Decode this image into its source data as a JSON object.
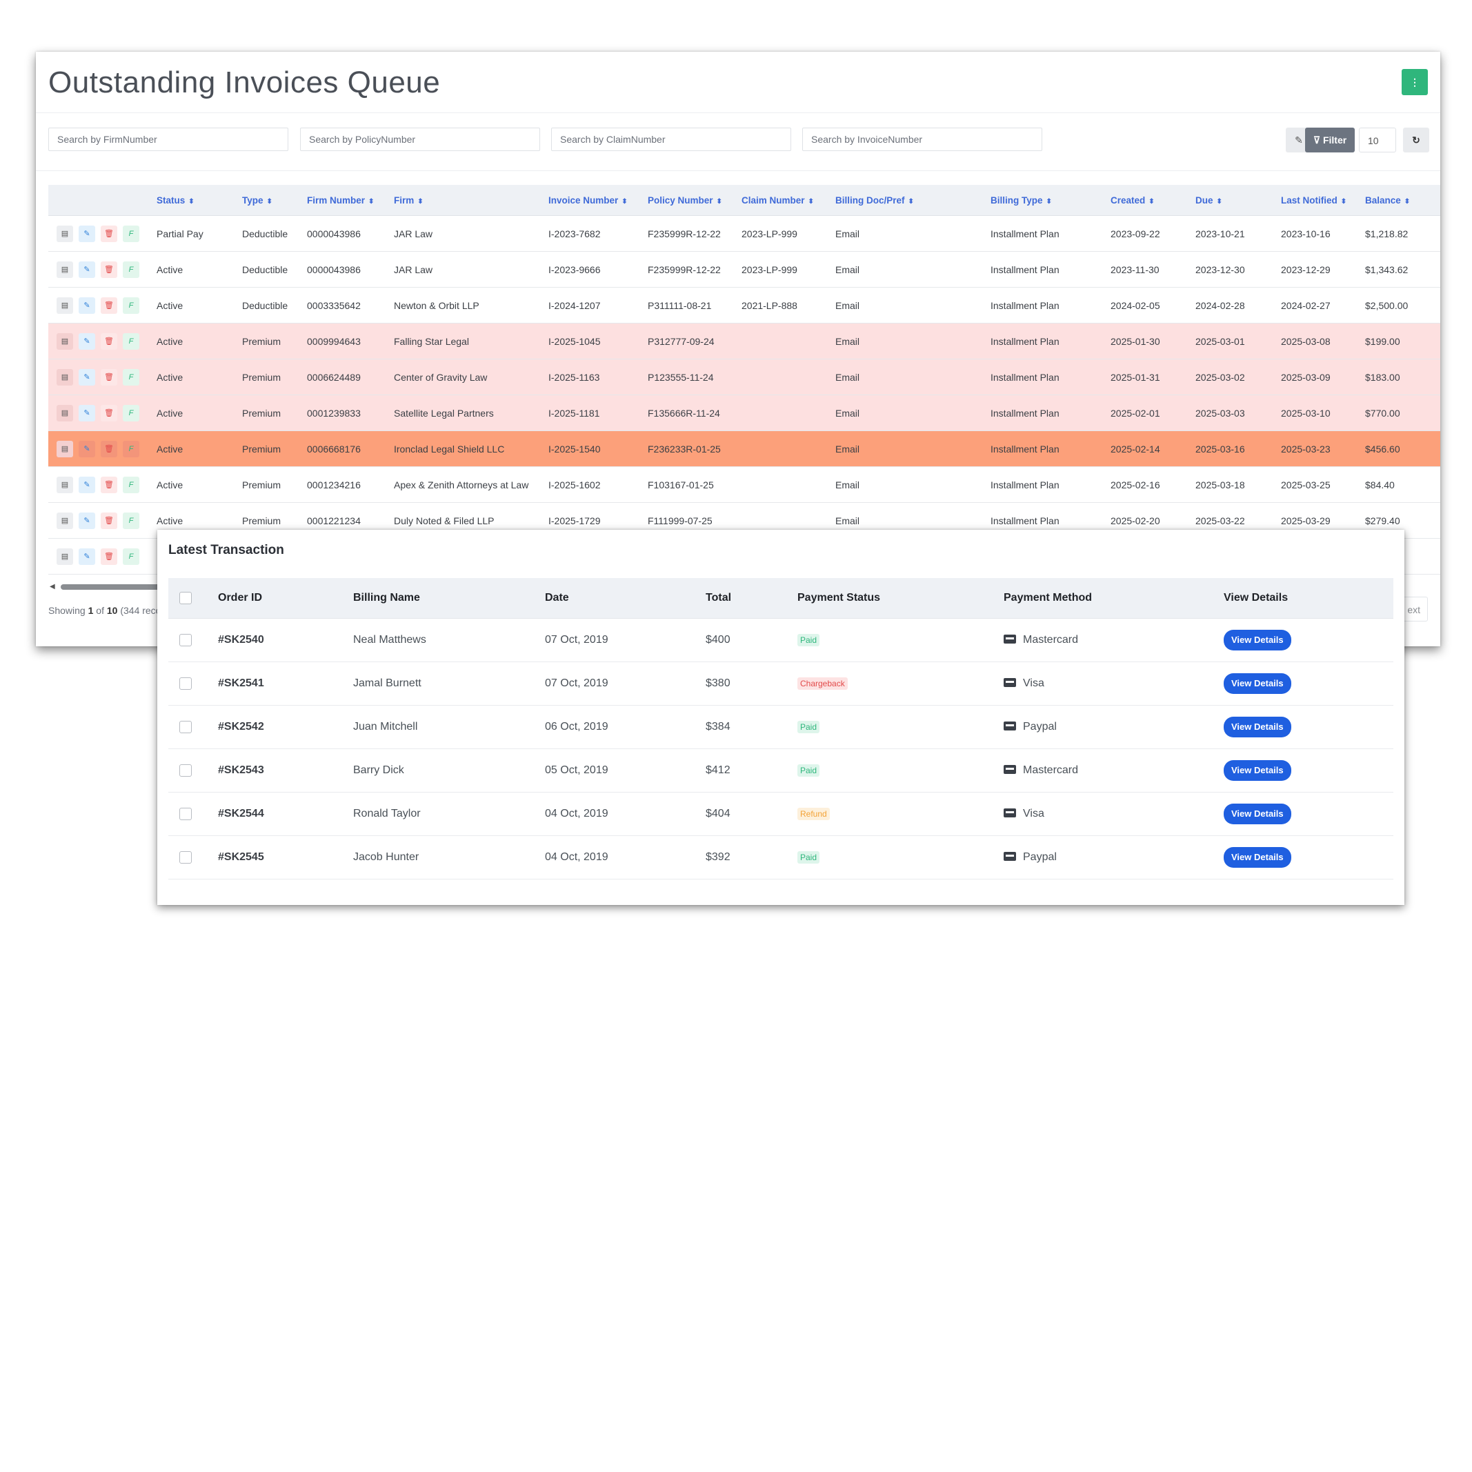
{
  "page": {
    "title": "Outstanding Invoices Queue",
    "menu_icon": "vertical-ellipsis-icon",
    "accent_color": "#2fb67c"
  },
  "search": {
    "firm": "Search by FirmNumber",
    "policy": "Search by PolicyNumber",
    "claim": "Search by ClaimNumber",
    "invoice": "Search by InvoiceNumber"
  },
  "toolbar": {
    "clear_icon": "eraser-icon",
    "filter_label": "⊽ Filter",
    "page_size": "10",
    "refresh_icon": "refresh-icon"
  },
  "invoices": {
    "columns": [
      "Status",
      "Type",
      "Firm Number",
      "Firm",
      "Invoice Number",
      "Policy Number",
      "Claim Number",
      "Billing Doc/Pref",
      "Billing Type",
      "Created",
      "Due",
      "Last Notified",
      "Balance"
    ],
    "rows": [
      {
        "highlight": "none",
        "cells": [
          "Partial Pay",
          "Deductible",
          "0000043986",
          "JAR Law",
          "I-2023-7682",
          "F235999R-12-22",
          "2023-LP-999",
          "Email",
          "Installment Plan",
          "2023-09-22",
          "2023-10-21",
          "2023-10-16",
          "$1,218.82"
        ]
      },
      {
        "highlight": "none",
        "cells": [
          "Active",
          "Deductible",
          "0000043986",
          "JAR Law",
          "I-2023-9666",
          "F235999R-12-22",
          "2023-LP-999",
          "Email",
          "Installment Plan",
          "2023-11-30",
          "2023-12-30",
          "2023-12-29",
          "$1,343.62"
        ]
      },
      {
        "highlight": "none",
        "cells": [
          "Active",
          "Deductible",
          "0003335642",
          "Newton & Orbit LLP",
          "I-2024-1207",
          "P311111-08-21",
          "2021-LP-888",
          "Email",
          "Installment Plan",
          "2024-02-05",
          "2024-02-28",
          "2024-02-27",
          "$2,500.00"
        ]
      },
      {
        "highlight": "pink",
        "cells": [
          "Active",
          "Premium",
          "0009994643",
          "Falling Star Legal",
          "I-2025-1045",
          "P312777-09-24",
          "",
          "Email",
          "Installment Plan",
          "2025-01-30",
          "2025-03-01",
          "2025-03-08",
          "$199.00"
        ]
      },
      {
        "highlight": "pink",
        "cells": [
          "Active",
          "Premium",
          "0006624489",
          "Center of Gravity Law",
          "I-2025-1163",
          "P123555-11-24",
          "",
          "Email",
          "Installment Plan",
          "2025-01-31",
          "2025-03-02",
          "2025-03-09",
          "$183.00"
        ]
      },
      {
        "highlight": "pink",
        "cells": [
          "Active",
          "Premium",
          "0001239833",
          "Satellite Legal Partners",
          "I-2025-1181",
          "F135666R-11-24",
          "",
          "Email",
          "Installment Plan",
          "2025-02-01",
          "2025-03-03",
          "2025-03-10",
          "$770.00"
        ]
      },
      {
        "highlight": "orange",
        "cells": [
          "Active",
          "Premium",
          "0006668176",
          "Ironclad Legal Shield LLC",
          "I-2025-1540",
          "F236233R-01-25",
          "",
          "Email",
          "Installment Plan",
          "2025-02-14",
          "2025-03-16",
          "2025-03-23",
          "$456.60"
        ]
      },
      {
        "highlight": "none",
        "cells": [
          "Active",
          "Premium",
          "0001234216",
          "Apex & Zenith Attorneys at Law",
          "I-2025-1602",
          "F103167-01-25",
          "",
          "Email",
          "Installment Plan",
          "2025-02-16",
          "2025-03-18",
          "2025-03-25",
          "$84.40"
        ]
      },
      {
        "highlight": "none",
        "cells": [
          "Active",
          "Premium",
          "0001221234",
          "Duly Noted & Filed LLP",
          "I-2025-1729",
          "F111999-07-25",
          "",
          "Email",
          "Installment Plan",
          "2025-02-20",
          "2025-03-22",
          "2025-03-29",
          "$279.40"
        ]
      },
      {
        "highlight": "none",
        "cells": [
          "",
          "",
          "",
          "",
          "",
          "",
          "",
          "",
          "",
          "",
          "",
          "",
          ""
        ]
      }
    ],
    "row_action_icons": [
      "document-icon",
      "edit-icon",
      "delete-icon",
      "f-icon"
    ],
    "highlight_colors": {
      "pink": "#fde0e0",
      "orange": "#fca07a"
    }
  },
  "footer": {
    "showing_prefix": "Showing",
    "showing_page": "1",
    "showing_of": "of",
    "showing_total": "10",
    "showing_suffix": "(344 reco",
    "next_label": "ext"
  },
  "transactions": {
    "title": "Latest Transaction",
    "columns": [
      "Order ID",
      "Billing Name",
      "Date",
      "Total",
      "Payment Status",
      "Payment Method",
      "View Details"
    ],
    "rows": [
      {
        "order_id": "#SK2540",
        "name": "Neal Matthews",
        "date": "07 Oct, 2019",
        "total": "$400",
        "status": "Paid",
        "status_type": "paid",
        "method": "Mastercard",
        "method_icon": "mastercard-icon",
        "button": "View Details"
      },
      {
        "order_id": "#SK2541",
        "name": "Jamal Burnett",
        "date": "07 Oct, 2019",
        "total": "$380",
        "status": "Chargeback",
        "status_type": "chargeback",
        "method": "Visa",
        "method_icon": "visa-icon",
        "button": "View Details"
      },
      {
        "order_id": "#SK2542",
        "name": "Juan Mitchell",
        "date": "06 Oct, 2019",
        "total": "$384",
        "status": "Paid",
        "status_type": "paid",
        "method": "Paypal",
        "method_icon": "paypal-icon",
        "button": "View Details"
      },
      {
        "order_id": "#SK2543",
        "name": "Barry Dick",
        "date": "05 Oct, 2019",
        "total": "$412",
        "status": "Paid",
        "status_type": "paid",
        "method": "Mastercard",
        "method_icon": "mastercard-icon",
        "button": "View Details"
      },
      {
        "order_id": "#SK2544",
        "name": "Ronald Taylor",
        "date": "04 Oct, 2019",
        "total": "$404",
        "status": "Refund",
        "status_type": "refund",
        "method": "Visa",
        "method_icon": "visa-icon",
        "button": "View Details"
      },
      {
        "order_id": "#SK2545",
        "name": "Jacob Hunter",
        "date": "04 Oct, 2019",
        "total": "$392",
        "status": "Paid",
        "status_type": "paid",
        "method": "Paypal",
        "method_icon": "paypal-icon",
        "button": "View Details"
      }
    ],
    "button_color": "#1f5fe0"
  }
}
